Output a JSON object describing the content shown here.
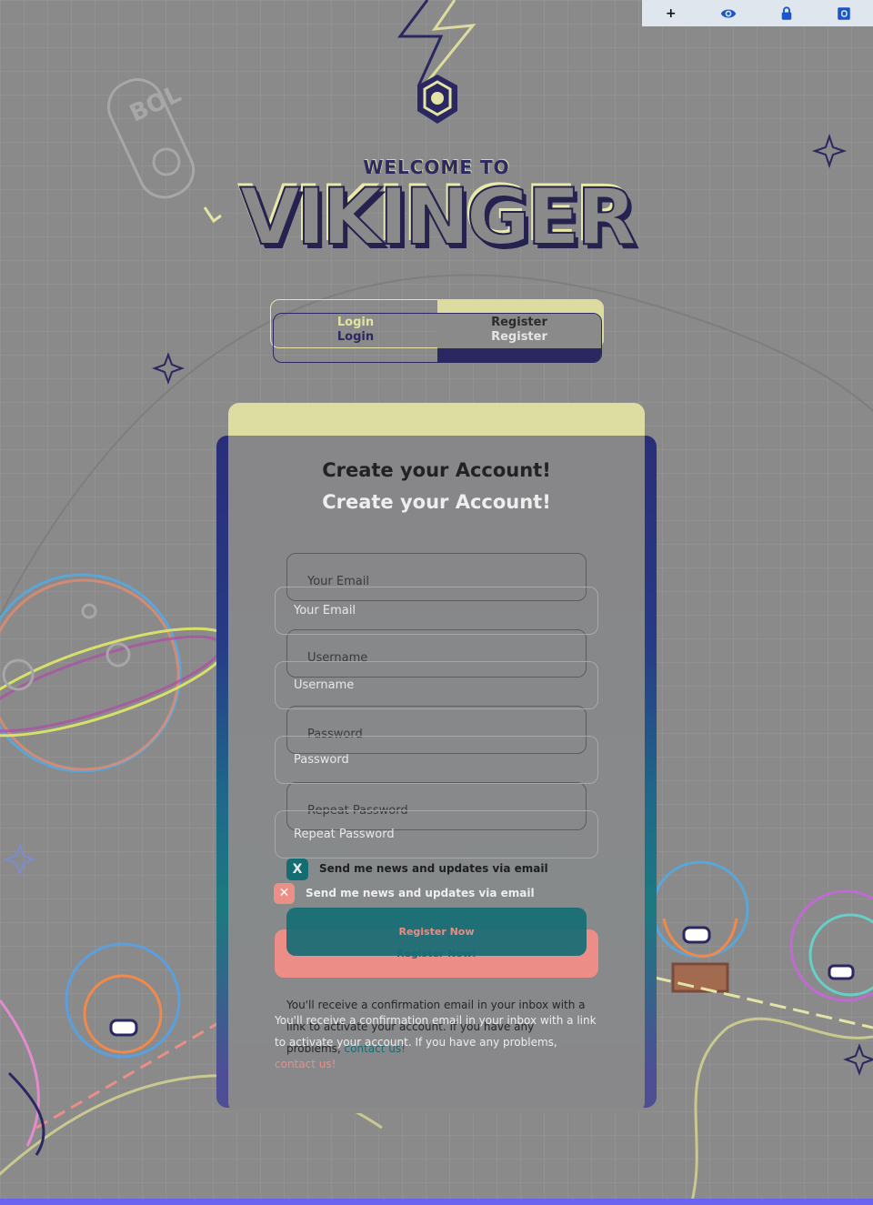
{
  "extension_bar": {
    "items": [
      {
        "icon": "plus-icon",
        "label": "+"
      },
      {
        "icon": "eye-icon",
        "label": ""
      },
      {
        "icon": "lock-icon",
        "label": ""
      },
      {
        "icon": "outlook-icon",
        "label": ""
      }
    ]
  },
  "header": {
    "welcome": "WELCOME TO",
    "brand": "VIKINGER"
  },
  "tabs": {
    "login": "Login",
    "register": "Register"
  },
  "card": {
    "title": "Create your Account!",
    "email_placeholder": "Your Email",
    "username_placeholder": "Username",
    "password_placeholder": "Password",
    "repeat_password_placeholder": "Repeat Password",
    "checkbox_back_mark": "X",
    "checkbox_front_mark": "✕",
    "newsletter_label": "Send me news and updates via email",
    "button_back_label": "Register Now",
    "button_front_label": "Register Now!",
    "info_text": "You'll receive a confirmation email in your inbox with a link to activate your account. If you have any problems, ",
    "info_link": "contact us!"
  },
  "colors": {
    "background": "#8a8a8a",
    "accent_yellow": "#e1e1a2",
    "accent_navy": "#2b2760",
    "accent_teal": "#156d74",
    "accent_coral": "#ec8e87",
    "bottom_bar": "#6b64f0"
  }
}
